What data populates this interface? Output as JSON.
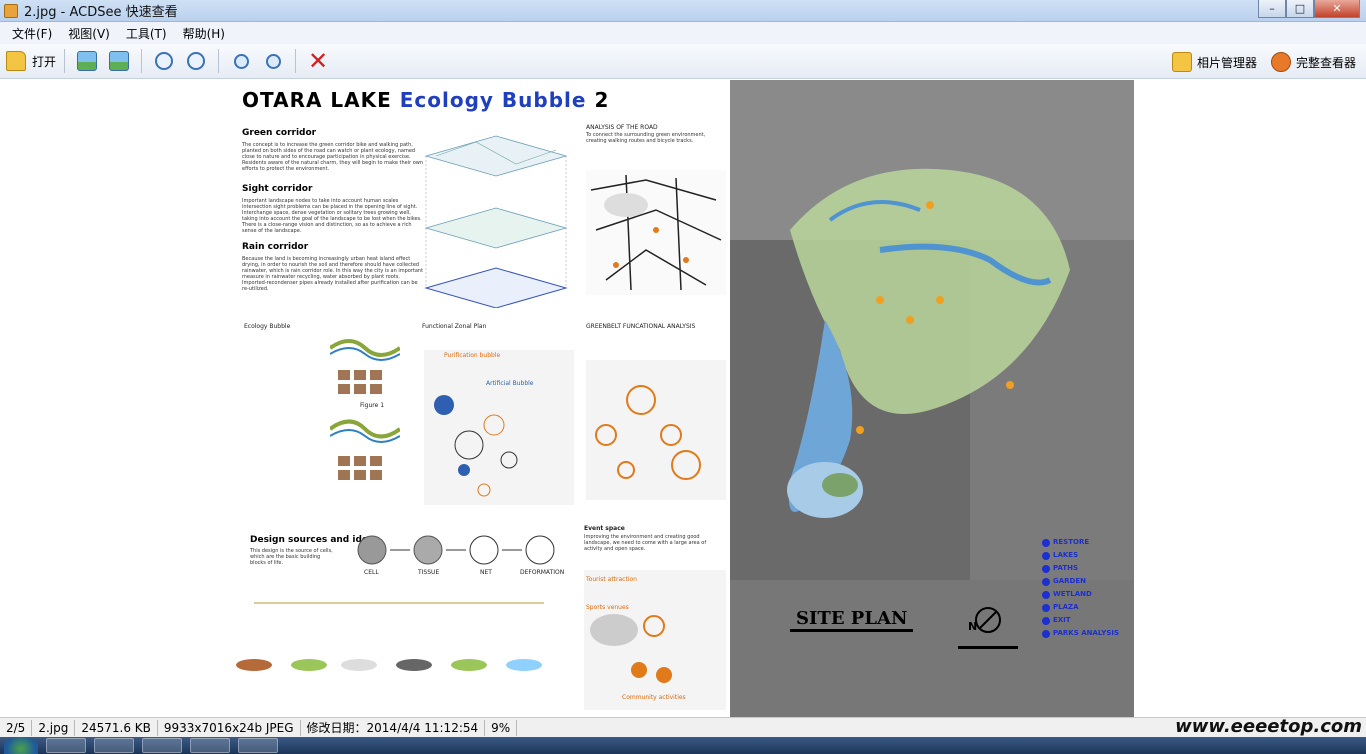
{
  "window": {
    "title": "2.jpg - ACDSee 快速查看",
    "buttons": {
      "minimize": "–",
      "maximize": "□",
      "close": "✕"
    }
  },
  "menu": [
    "文件(F)",
    "视图(V)",
    "工具(T)",
    "帮助(H)"
  ],
  "toolbar": {
    "open_label": "打开",
    "photo_manager_label": "相片管理器",
    "full_viewer_label": "完整查看器"
  },
  "poster": {
    "title_main": "OTARA LAKE ",
    "title_accent": "Ecology Bubble",
    "title_num": " 2",
    "green_corridor": "Green corridor",
    "green_corridor_text": "The concept is to increase the green corridor bike and walking path, planted on both sides of the road can watch or plant ecology, named close to nature and to encourage participation in physical exercise. Residents aware of the natural charm, they will begin to make their own efforts to protect the environment.",
    "sight_corridor": "Sight corridor",
    "sight_corridor_text": "Important landscape nodes to take into account human scales intersection sight problems can be placed in the opening line of sight. Interchange space, dense vegetation or solitary trees growing well, taking into account the goal of the landscape to be lost when the bikes. There is a close-range vision and distinction, so as to achieve a rich sense of the landscape.",
    "rain_corridor": "Rain corridor",
    "rain_corridor_text": "Because the land is becoming increasingly urban heat island effect drying, in order to nourish the soil and therefore should have collected rainwater, which is rain corridor role. In this way the city is an important measure in rainwater recycling, water absorbed by plant roots. Imported-recondenser pipes already installed after purification can be re-utilized.",
    "analysis_road": "ANALYSIS OF THE ROAD",
    "analysis_road_text": "To connect the surrounding green environment, creating walking routes and bicycle tracks.",
    "ecology_bubble": "Ecology Bubble",
    "functional_zonal": "Functional Zonal Plan",
    "greenbelt_analysis": "GREENBELT FUNCATIONAL ANALYSIS",
    "purification_bubble": "Purification bubble",
    "artificial_bubble": "Artificial Bubble",
    "figure_label": "Figure 1",
    "design_sources": "Design sources and ideas",
    "design_sources_text": "This design is the source of cells, which are the basic building blocks of life.",
    "design_steps": [
      "CELL",
      "TISSUE",
      "NET",
      "DEFORMATION"
    ],
    "event_space": "Event space",
    "event_space_text": "Improving the environment and creating good landscape, we need to come with a large area of activity and open space.",
    "tourist_attraction": "Tourist attraction",
    "sports_venues": "Sports venues",
    "community_activities": "Community activities"
  },
  "site_plan": {
    "title": "SITE PLAN",
    "north": "N",
    "legend": [
      "RESTORE",
      "LAKES",
      "PATHS",
      "GARDEN",
      "WETLAND",
      "PLAZA",
      "EXIT",
      "PARKS ANALYSIS"
    ]
  },
  "status": {
    "index": "2/5",
    "filename": "2.jpg",
    "filesize": "24571.6 KB",
    "dimensions": "9933x7016x24b JPEG",
    "modified": "修改日期：2014/4/4 11:12:54",
    "zoom": "9%",
    "watermark": "www.eeeetop.com"
  },
  "colors": {
    "accent_title": "#1f3fbf",
    "orange": "#d96a12",
    "legend_blue": "#1c2fd0"
  }
}
